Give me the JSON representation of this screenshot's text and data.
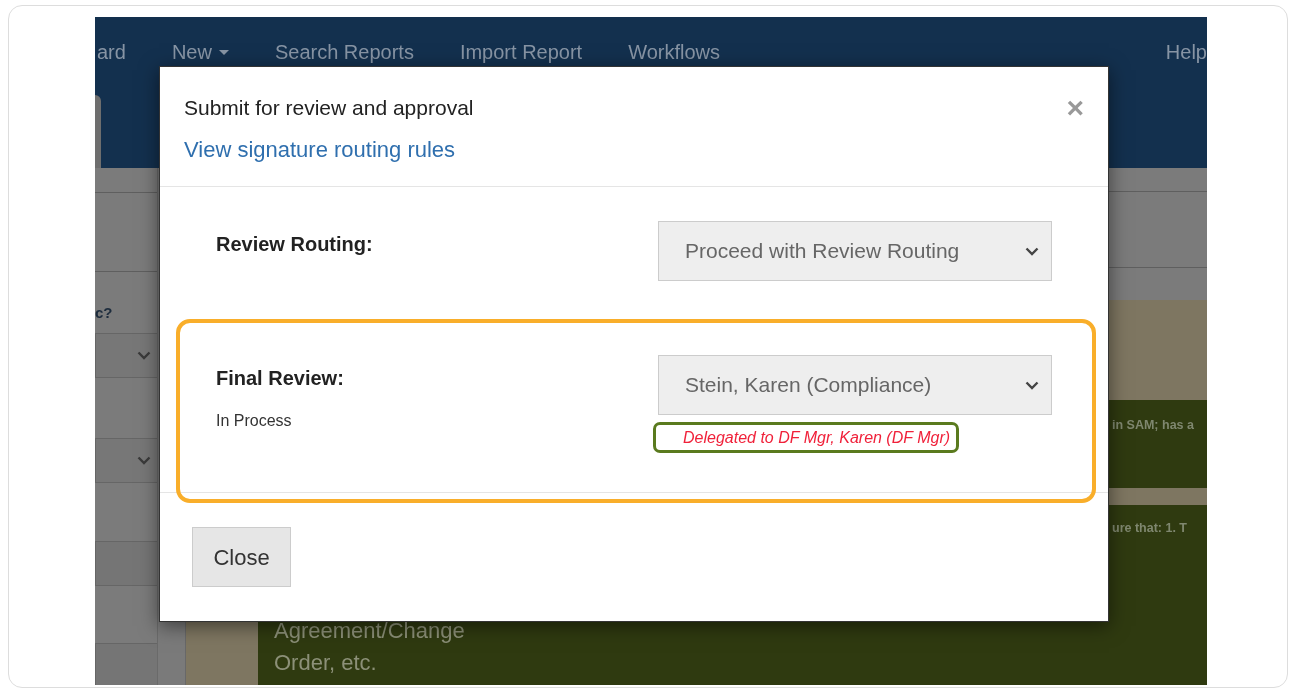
{
  "navbar": {
    "items": [
      {
        "label": "ard",
        "dropdown": false
      },
      {
        "label": "New",
        "dropdown": true
      },
      {
        "label": "Search Reports",
        "dropdown": false
      },
      {
        "label": "Import Report",
        "dropdown": false
      },
      {
        "label": "Workflows",
        "dropdown": false
      },
      {
        "label": "Help",
        "dropdown": false
      }
    ]
  },
  "sidebar": {
    "question": "c?"
  },
  "content": {
    "snippets": [
      "in SAM; has a",
      "ure that: 1. T"
    ],
    "cell_lines": [
      "Agreement/Change",
      "Order, etc."
    ]
  },
  "modal": {
    "title": "Submit for review and approval",
    "link": "View signature routing rules",
    "close": "×",
    "rows": [
      {
        "label": "Review Routing:",
        "value": "Proceed with Review Routing",
        "highlighted": false
      },
      {
        "label": "Final Review:",
        "status": "In Process",
        "value": "Stein, Karen (Compliance)",
        "note": "Delegated to DF Mgr, Karen (DF Mgr)",
        "highlighted": true
      }
    ],
    "buttons": [
      "Close"
    ]
  }
}
